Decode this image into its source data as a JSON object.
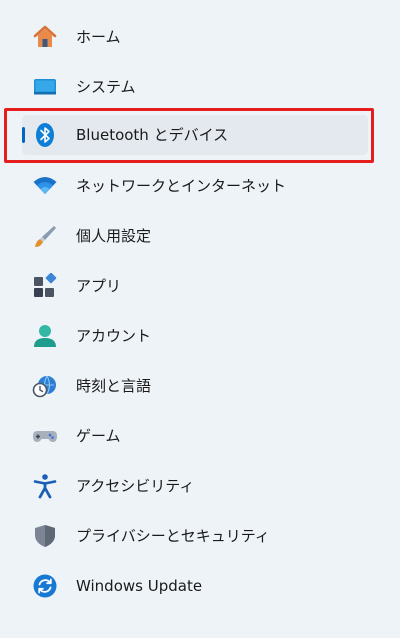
{
  "colors": {
    "background": "#eef3f8",
    "selected_bg": "#e4e9ef",
    "accent": "#0067c0",
    "highlight_border": "#e51d1d"
  },
  "nav": {
    "items": [
      {
        "label": "ホーム",
        "icon": "home-icon"
      },
      {
        "label": "システム",
        "icon": "system-icon"
      },
      {
        "label": "Bluetooth とデバイス",
        "icon": "bluetooth-icon",
        "selected": true
      },
      {
        "label": "ネットワークとインターネット",
        "icon": "wifi-icon"
      },
      {
        "label": "個人用設定",
        "icon": "brush-icon"
      },
      {
        "label": "アプリ",
        "icon": "apps-icon"
      },
      {
        "label": "アカウント",
        "icon": "account-icon"
      },
      {
        "label": "時刻と言語",
        "icon": "time-language-icon"
      },
      {
        "label": "ゲーム",
        "icon": "gamepad-icon"
      },
      {
        "label": "アクセシビリティ",
        "icon": "accessibility-icon"
      },
      {
        "label": "プライバシーとセキュリティ",
        "icon": "shield-icon"
      },
      {
        "label": "Windows Update",
        "icon": "update-icon"
      }
    ]
  }
}
